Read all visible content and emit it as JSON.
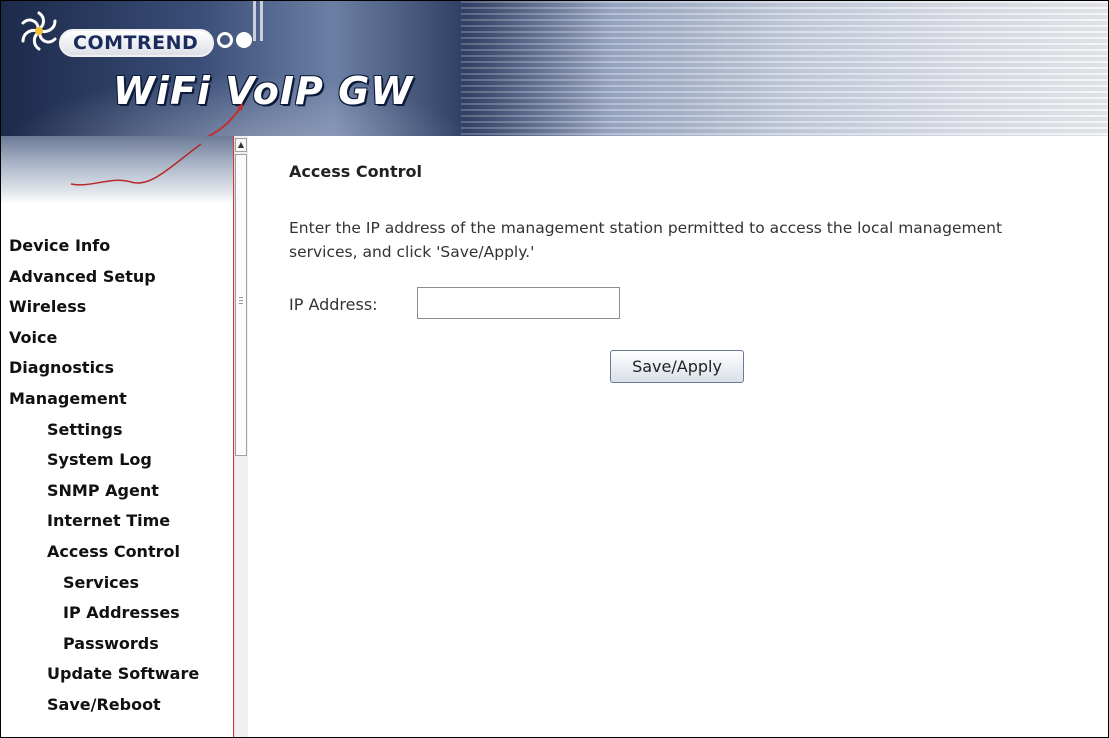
{
  "banner": {
    "brand": "COMTREND",
    "product": "WiFi VoIP GW"
  },
  "sidebar": {
    "items": [
      {
        "label": "Device Info"
      },
      {
        "label": "Advanced Setup"
      },
      {
        "label": "Wireless"
      },
      {
        "label": "Voice"
      },
      {
        "label": "Diagnostics"
      },
      {
        "label": "Management"
      },
      {
        "label": "Settings"
      },
      {
        "label": "System Log"
      },
      {
        "label": "SNMP Agent"
      },
      {
        "label": "Internet Time"
      },
      {
        "label": "Access Control"
      },
      {
        "label": "Services"
      },
      {
        "label": "IP Addresses"
      },
      {
        "label": "Passwords"
      },
      {
        "label": "Update Software"
      },
      {
        "label": "Save/Reboot"
      }
    ]
  },
  "main": {
    "title": "Access Control",
    "description": "Enter the IP address of the management station permitted to access the local management services, and click 'Save/Apply.'",
    "ip_label": "IP Address:",
    "ip_value": "",
    "save_label": "Save/Apply"
  },
  "colors": {
    "sidebar_border": "#d23a3a",
    "banner_dark": "#1c2a4a"
  }
}
